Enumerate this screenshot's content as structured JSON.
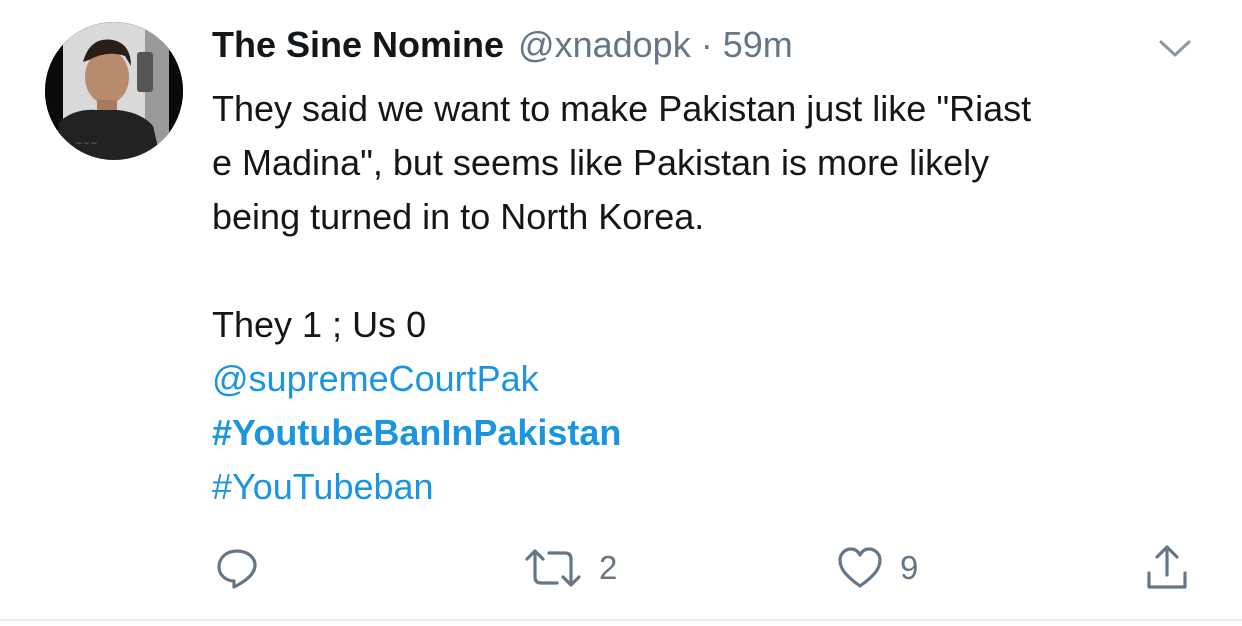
{
  "tweet": {
    "display_name": "The Sine Nomine",
    "handle": "@xnadopk",
    "separator": "·",
    "time": "59m",
    "avatar_icon": "user-avatar-photo",
    "menu_icon": "chevron-down-icon",
    "body": {
      "line1": "They said we want to make Pakistan just like \"Riast",
      "line2": "e Madina\", but seems like Pakistan is more likely",
      "line3": "being turned in to North Korea.",
      "line4": "They 1 ; Us 0",
      "mention": "@supremeCourtPak",
      "hashtag1": "#YoutubeBanInPakistan",
      "hashtag2": "#YouTubeban"
    },
    "actions": {
      "reply_icon": "reply-icon",
      "retweet_icon": "retweet-icon",
      "retweet_count": "2",
      "like_icon": "heart-icon",
      "like_count": "9",
      "share_icon": "share-icon"
    },
    "colors": {
      "text": "#14171a",
      "secondary": "#657786",
      "link": "#1b95e0",
      "border": "#e6ecf0"
    }
  }
}
